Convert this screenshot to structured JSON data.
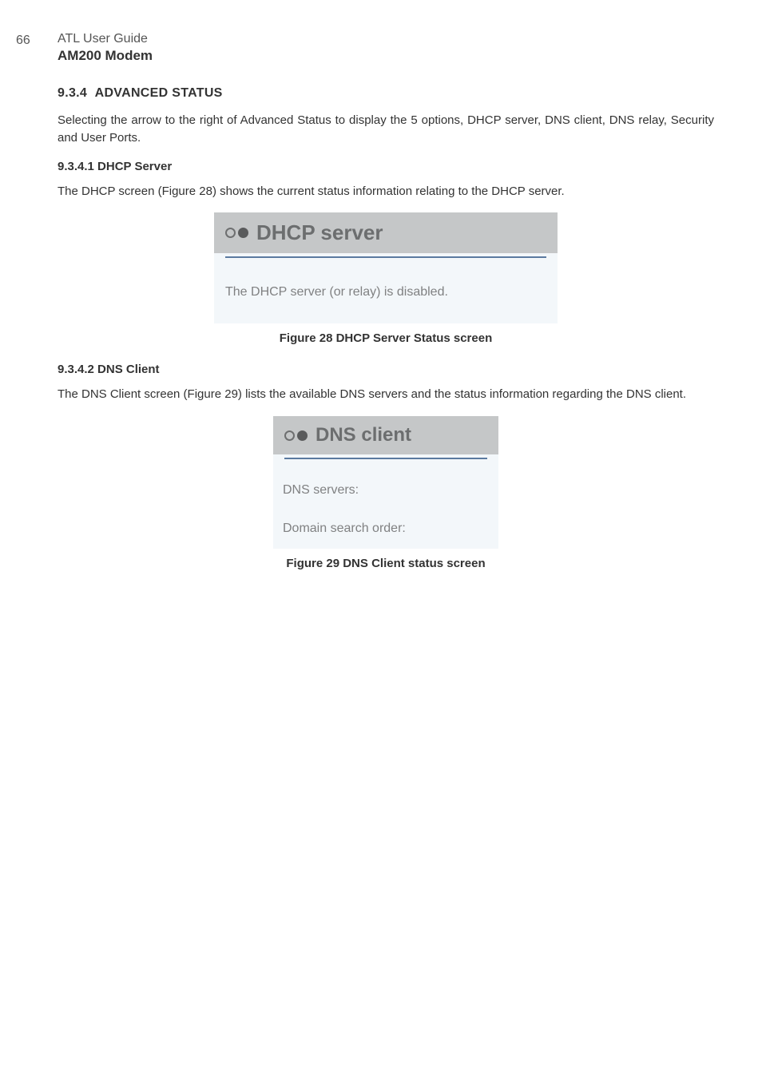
{
  "pageNumber": "66",
  "guideTitle": "ATL User Guide",
  "productTitle": "AM200 Modem",
  "section": {
    "number": "9.3.4",
    "title": "ADVANCED STATUS",
    "intro": "Selecting the arrow to the right of Advanced Status to display the 5 options, DHCP server, DNS client, DNS relay, Security and User Ports."
  },
  "sub1": {
    "number": "9.3.4.1",
    "title": "DHCP Server",
    "text": "The DHCP screen (Figure 28) shows the current status information relating to the DHCP server."
  },
  "figure28": {
    "headerTitle": "DHCP server",
    "bodyText": "The DHCP server (or relay) is disabled.",
    "caption": "Figure 28 DHCP Server Status screen"
  },
  "sub2": {
    "number": "9.3.4.2",
    "title": "DNS Client",
    "text": "The DNS Client screen (Figure 29) lists the available DNS servers and the status information regarding the DNS client."
  },
  "figure29": {
    "headerTitle": "DNS client",
    "line1": "DNS servers:",
    "line2": "Domain search order:",
    "caption": "Figure 29 DNS Client status screen"
  }
}
